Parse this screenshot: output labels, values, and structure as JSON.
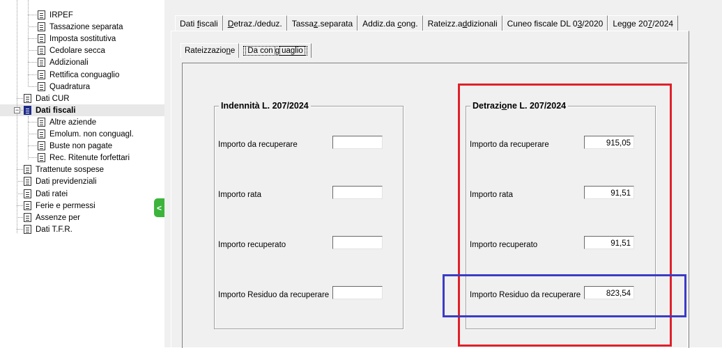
{
  "tree": {
    "items": [
      {
        "label": "IRPEF",
        "level": 2
      },
      {
        "label": "Tassazione separata",
        "level": 2
      },
      {
        "label": "Imposta sostitutiva",
        "level": 2
      },
      {
        "label": "Cedolare secca",
        "level": 2
      },
      {
        "label": "Addizionali",
        "level": 2
      },
      {
        "label": "Rettifica conguaglio",
        "level": 2
      },
      {
        "label": "Quadratura",
        "level": 2
      },
      {
        "label": "Dati CUR",
        "level": 1
      },
      {
        "label": "Dati fiscali",
        "level": 1,
        "selected": true
      },
      {
        "label": "Altre aziende",
        "level": 2
      },
      {
        "label": "Emolum. non conguagl.",
        "level": 2
      },
      {
        "label": "Buste non pagate",
        "level": 2
      },
      {
        "label": "Rec. Ritenute forfettari",
        "level": 2
      },
      {
        "label": "Trattenute sospese",
        "level": 1
      },
      {
        "label": "Dati previdenziali",
        "level": 1
      },
      {
        "label": "Dati ratei",
        "level": 1
      },
      {
        "label": "Ferie e permessi",
        "level": 1
      },
      {
        "label": "Assenze per",
        "level": 1
      },
      {
        "label": "Dati T.F.R.",
        "level": 1
      }
    ],
    "expander_symbol": "−",
    "collapse_button_symbol": "<"
  },
  "main_tabs": [
    {
      "pre": "Dati ",
      "u": "f",
      "post": "iscali"
    },
    {
      "pre": "",
      "u": "D",
      "post": "etraz./deduz."
    },
    {
      "pre": "Tassa",
      "u": "z",
      "post": ".separata"
    },
    {
      "pre": "Addiz.da ",
      "u": "c",
      "post": "ong."
    },
    {
      "pre": "Rateizz.a",
      "u": "d",
      "post": "dizionali"
    },
    {
      "pre": "Cuneo fiscale DL 0",
      "u": "3",
      "post": "/2020"
    },
    {
      "pre": "Legge 20",
      "u": "7",
      "post": "/2024",
      "active": true
    }
  ],
  "sub_tabs": [
    {
      "pre": "Rateizzazio",
      "u": "n",
      "post": "e"
    },
    {
      "pre": "Da con",
      "u": "g",
      "post": "uaglio",
      "active": true
    }
  ],
  "group_left": {
    "title": "Indennità L. 207/2024",
    "fields": [
      {
        "label": "Importo da recuperare",
        "value": ""
      },
      {
        "label": "Importo rata",
        "value": ""
      },
      {
        "label": "Importo recuperato",
        "value": ""
      },
      {
        "label": "Importo Residuo da recuperare",
        "value": ""
      }
    ]
  },
  "group_right": {
    "title_pre": "Detrazi",
    "title_u": "o",
    "title_post": "ne L. 207/2024",
    "fields": [
      {
        "label": "Importo da recuperare",
        "value": "915,05"
      },
      {
        "label": "Importo rata",
        "value": "91,51"
      },
      {
        "label": "Importo recuperato",
        "value": "91,51"
      },
      {
        "label": "Importo Residuo da recuperare",
        "value": "823,54"
      }
    ]
  },
  "annotation_colors": {
    "red_box": "#e0202a",
    "blue_box": "#3b3cc4"
  }
}
